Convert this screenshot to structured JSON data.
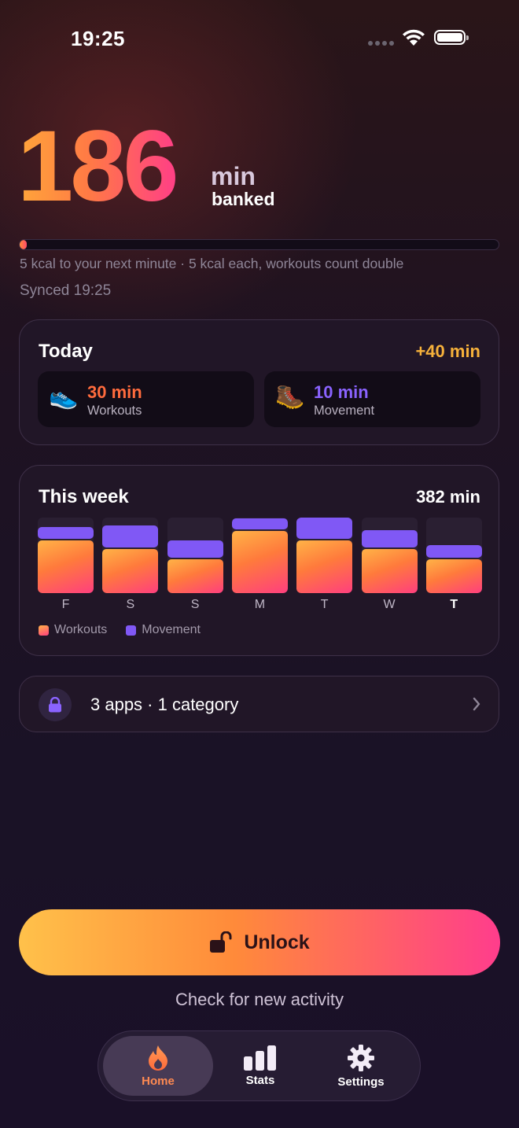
{
  "status_bar": {
    "time": "19:25"
  },
  "hero": {
    "banked_value": "186",
    "unit": "min",
    "unit_sub": "banked",
    "progress_fraction": 0.01,
    "hint": "5 kcal to your next minute · 5 kcal each, workouts count double",
    "synced": "Synced 19:25"
  },
  "today": {
    "title": "Today",
    "delta": "+40 min",
    "workouts": {
      "value": "30 min",
      "label": "Workouts",
      "icon": "running-shoe-icon",
      "color": "#ff6b3d"
    },
    "movement": {
      "value": "10 min",
      "label": "Movement",
      "icon": "hiking-boot-icon",
      "color": "#8a63ff"
    }
  },
  "week": {
    "title": "This week",
    "total": "382 min",
    "days": [
      {
        "label": "F",
        "workouts": 70,
        "movement": 15,
        "current": false
      },
      {
        "label": "S",
        "workouts": 58,
        "movement": 30,
        "current": false
      },
      {
        "label": "S",
        "workouts": 45,
        "movement": 23,
        "current": false
      },
      {
        "label": "M",
        "workouts": 82,
        "movement": 15,
        "current": false
      },
      {
        "label": "T",
        "workouts": 70,
        "movement": 31,
        "current": false
      },
      {
        "label": "W",
        "workouts": 58,
        "movement": 23,
        "current": false
      },
      {
        "label": "T",
        "workouts": 45,
        "movement": 16,
        "current": true
      }
    ],
    "max": 100,
    "legend": {
      "workouts": "Workouts",
      "movement": "Movement"
    },
    "colors": {
      "workouts": "#ff7a3c",
      "movement": "#8058f5"
    }
  },
  "apps": {
    "label": "3 apps · 1 category"
  },
  "unlock": {
    "label": "Unlock"
  },
  "check_activity": "Check for new activity",
  "tabs": [
    {
      "label": "Home",
      "icon": "flame-icon",
      "active": true
    },
    {
      "label": "Stats",
      "icon": "bar-chart-icon",
      "active": false
    },
    {
      "label": "Settings",
      "icon": "gear-icon",
      "active": false
    }
  ]
}
